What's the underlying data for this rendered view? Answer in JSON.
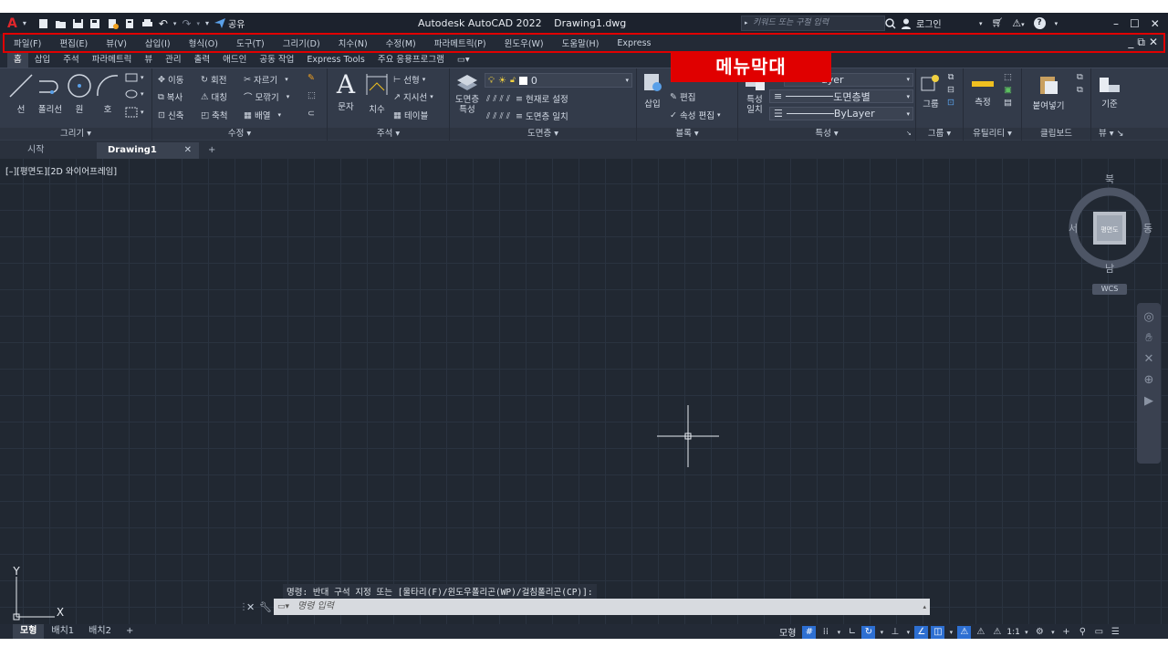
{
  "title": {
    "app": "Autodesk AutoCAD 2022",
    "file": "Drawing1.dwg"
  },
  "quick_access": {
    "share_label": "공유"
  },
  "search": {
    "placeholder": "키워드 또는 구절 입력"
  },
  "account": {
    "login_label": "로그인"
  },
  "menu": [
    "파일(F)",
    "편집(E)",
    "뷰(V)",
    "삽입(I)",
    "형식(O)",
    "도구(T)",
    "그리기(D)",
    "치수(N)",
    "수정(M)",
    "파라메트릭(P)",
    "윈도우(W)",
    "도움말(H)",
    "Express"
  ],
  "overlay_label": "메뉴막대",
  "ribbon_tabs": [
    "홈",
    "삽입",
    "주석",
    "파라메트릭",
    "뷰",
    "관리",
    "출력",
    "애드인",
    "공동 작업",
    "Express Tools",
    "주요 응용프로그램"
  ],
  "panels": {
    "draw": {
      "title": "그리기",
      "line": "선",
      "polyline": "폴리선",
      "circle": "원",
      "arc": "호"
    },
    "modify": {
      "title": "수정",
      "move": "이동",
      "rotate": "회전",
      "trim": "자르기",
      "copy": "복사",
      "mirror": "대칭",
      "fillet": "모깎기",
      "stretch": "신축",
      "scale": "축척",
      "array": "배열"
    },
    "annotation": {
      "title": "주석",
      "text": "문자",
      "dimension": "치수",
      "linear": "선형",
      "leader": "지시선",
      "table": "테이블"
    },
    "layers": {
      "title": "도면층",
      "layer_props_1": "도면층",
      "layer_props_2": "특성",
      "layer_value": "0",
      "set_current": "현재로 설정",
      "match_layer": "도면층 일치"
    },
    "block": {
      "title": "블록",
      "insert": "삽입",
      "edit": "편집",
      "edit_attr": "속성 편집"
    },
    "properties": {
      "title": "특성",
      "match_1": "특성",
      "match_2": "일치",
      "color_value": "ayer",
      "linetype_value": "도면층별",
      "lineweight_value": "ByLayer"
    },
    "groups": {
      "title": "그룹",
      "group": "그룹"
    },
    "utilities": {
      "title": "유틸리티",
      "measure": "측정"
    },
    "clipboard": {
      "title": "클립보드",
      "paste": "붙여넣기"
    },
    "view": {
      "title": "뷰",
      "base": "기준"
    }
  },
  "file_tabs": [
    "시작",
    "Drawing1"
  ],
  "viewport_label": "[–][평면도][2D 와이어프레임]",
  "viewcube": {
    "north": "북",
    "south": "남",
    "east": "동",
    "west": "서",
    "face": "평면도",
    "wcs": "WCS"
  },
  "ucs": {
    "x": "X",
    "y": "Y"
  },
  "command": {
    "history": "명령: 반대 구석 지정 또는 [울타리(F)/윈도우폴리곤(WP)/걸침폴리곤(CP)]:",
    "placeholder": "명령 입력"
  },
  "layout_tabs": [
    "모형",
    "배치1",
    "배치2"
  ],
  "status": {
    "model": "모형",
    "scale": "1:1"
  }
}
